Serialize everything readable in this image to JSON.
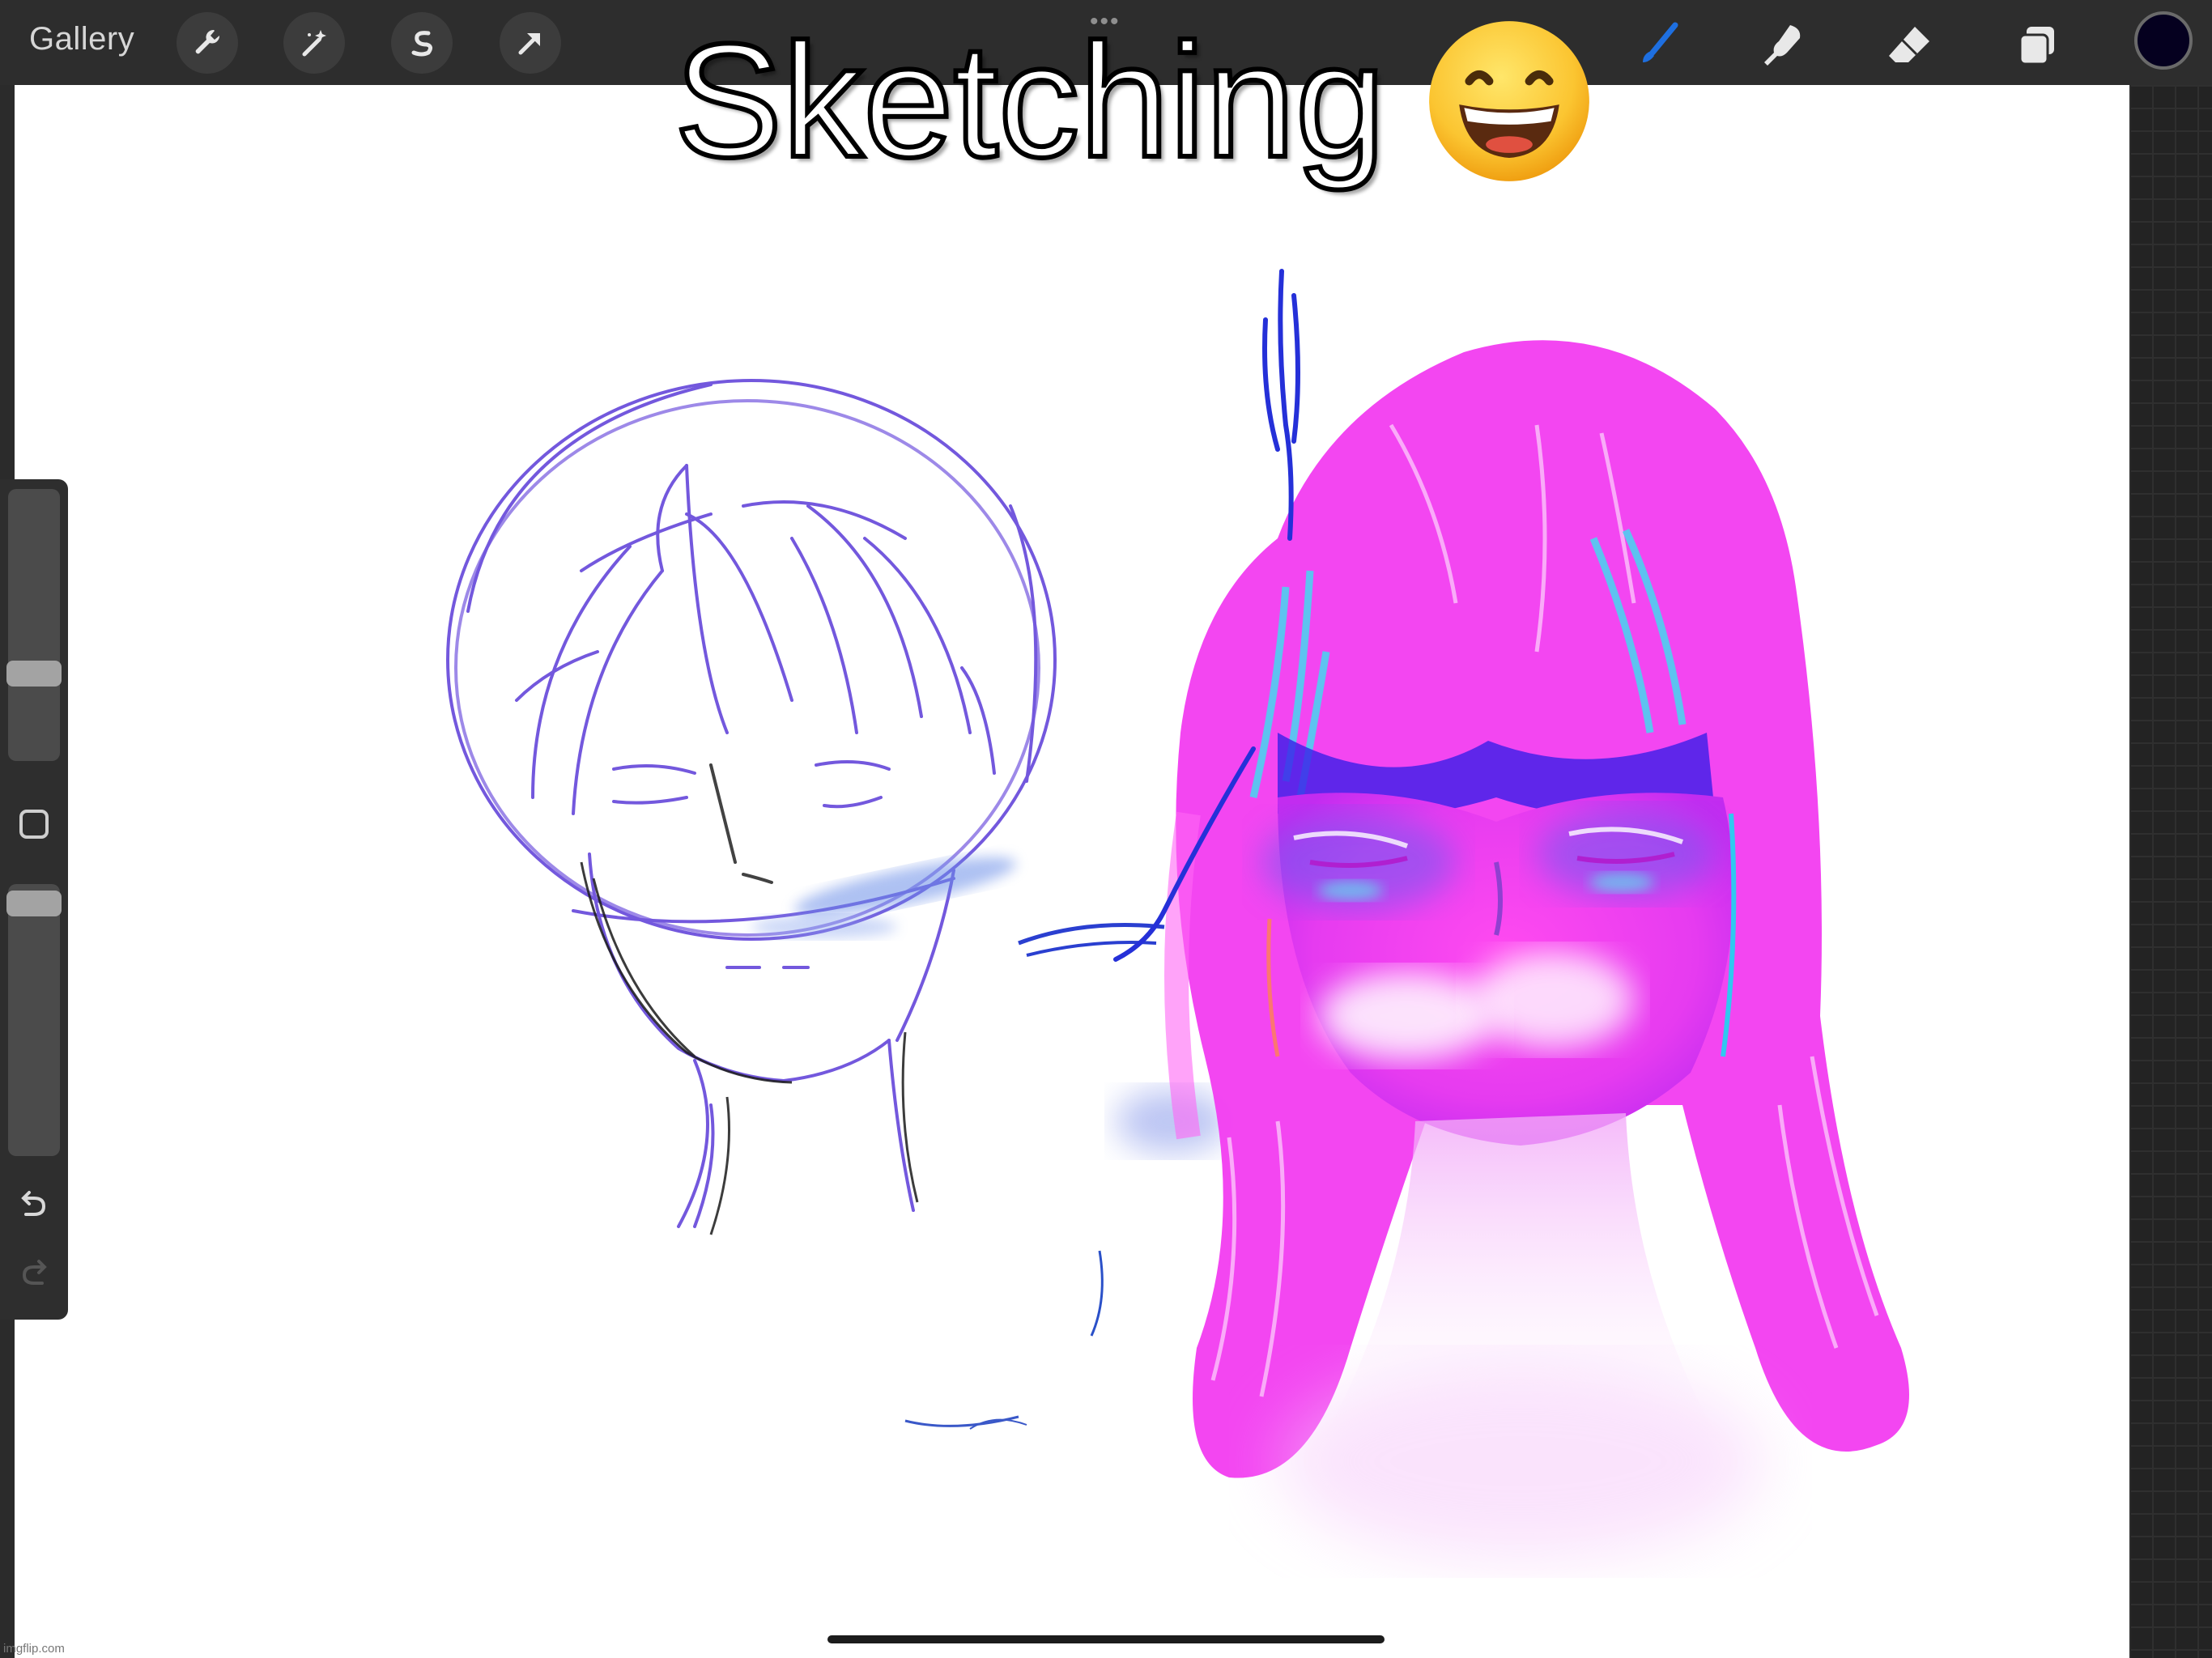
{
  "toolbar": {
    "gallery_label": "Gallery",
    "left_tools": [
      "wrench-icon",
      "magic-wand-icon",
      "selection-icon",
      "transform-arrow-icon"
    ],
    "right_tools": [
      "brush-icon",
      "smudge-icon",
      "eraser-icon",
      "layers-icon"
    ],
    "grab_handle": "•••",
    "current_color": "#05001f",
    "accent_color": "#1e6fe0"
  },
  "caption": {
    "text": "Sketching",
    "emoji": "grinning-face-emoji"
  },
  "sidebar": {
    "brush_size_level": 0.35,
    "opacity_level": 0.95,
    "modify_button": "eyedropper-square-icon",
    "undo_icon": "undo-icon",
    "redo_icon": "redo-icon"
  },
  "watermark": {
    "text": "imgflip.com"
  }
}
